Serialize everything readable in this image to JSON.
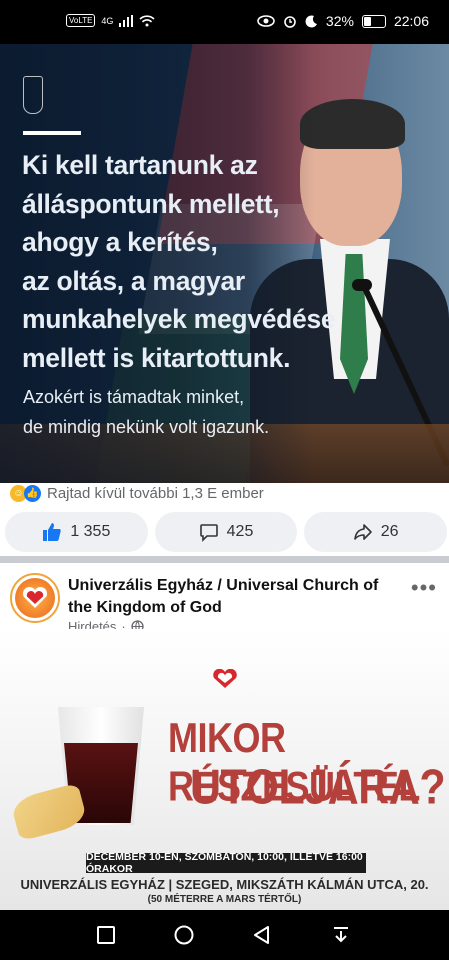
{
  "status_bar": {
    "network_badge": "VoLTE",
    "network_type": "4G",
    "battery": "32%",
    "battery_fraction": 0.32,
    "time": "22:06"
  },
  "post1": {
    "headline_lines": [
      "Ki kell tartanunk az",
      "álláspontunk mellett,",
      "ahogy a kerítés,",
      "az oltás, a magyar",
      "munkahelyek megvédése",
      "mellett is kitartottunk."
    ],
    "subline_lines": [
      "Azokért is támadtak minket,",
      "de mindig nekünk volt igazunk."
    ],
    "reactions_text": "Rajtad kívül további 1,3 E ember",
    "like_count": "1 355",
    "comment_count": "425",
    "share_count": "26"
  },
  "post2": {
    "page_name": "Univerzális Egyház / Universal Church of the Kingdom of God",
    "meta_label": "Hirdetés",
    "meta_separator": "·",
    "ad": {
      "title_line1": "MIKOR RÉSZESÜLTÉL",
      "title_line2": "UTOLJÁRA?",
      "band_text": "DECEMBER 10-ÉN, SZOMBATON, 10:00, ILLETVE 16:00 ÓRAKOR",
      "address": "UNIVERZÁLIS EGYHÁZ | SZEGED, MIKSZÁTH KÁLMÁN UTCA, 20.",
      "note": "(50 MÉTERRE A MARS TÉRTŐL)"
    }
  },
  "colors": {
    "facebook_blue": "#1877f2",
    "ad_red": "#b3403a",
    "divider": "#c9ccd1"
  },
  "icons": [
    "signal-icon",
    "wifi-icon",
    "eye-icon",
    "alarm-icon",
    "moon-icon",
    "battery-icon",
    "like-icon",
    "comment-icon",
    "share-icon",
    "globe-icon",
    "more-icon",
    "back-icon",
    "home-icon",
    "recents-icon",
    "notification-pull-icon"
  ]
}
